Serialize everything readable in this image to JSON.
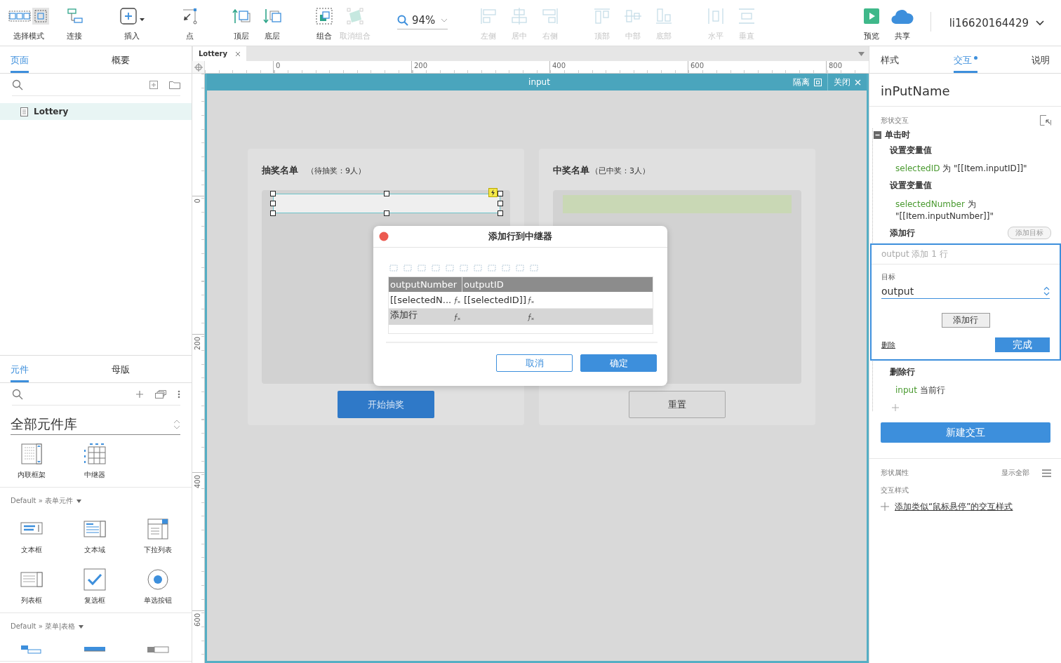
{
  "toolbar": {
    "left_groups": [
      {
        "items": [
          {
            "label": "选择模式",
            "disabled": false
          },
          {
            "label": "连接",
            "disabled": false
          }
        ]
      },
      {
        "items": [
          {
            "label": "插入",
            "disabled": false
          }
        ]
      },
      {
        "items": [
          {
            "label": "点",
            "disabled": false
          }
        ]
      },
      {
        "items": [
          {
            "label": "顶层",
            "disabled": false
          },
          {
            "label": "底层",
            "disabled": false
          }
        ]
      },
      {
        "items": [
          {
            "label": "组合",
            "disabled": false
          },
          {
            "label": "取消组合",
            "disabled": true
          }
        ]
      }
    ],
    "zoom": "94%",
    "align_groups": [
      {
        "items": [
          {
            "label": "左侧",
            "disabled": true
          },
          {
            "label": "居中",
            "disabled": true
          },
          {
            "label": "右侧",
            "disabled": true
          }
        ]
      },
      {
        "items": [
          {
            "label": "顶部",
            "disabled": true
          },
          {
            "label": "中部",
            "disabled": true
          },
          {
            "label": "底部",
            "disabled": true
          }
        ]
      },
      {
        "items": [
          {
            "label": "水平",
            "disabled": true
          },
          {
            "label": "垂直",
            "disabled": true
          }
        ]
      }
    ],
    "right_items": [
      {
        "label": "预览"
      },
      {
        "label": "共享"
      }
    ],
    "user": "li16620164429"
  },
  "left_panel": {
    "pages": {
      "tabs": [
        {
          "label": "页面",
          "selected": true
        },
        {
          "label": "概要",
          "selected": false
        }
      ],
      "items": [
        {
          "label": "Lottery",
          "selected": true
        }
      ]
    },
    "library": {
      "tabs": [
        {
          "label": "元件",
          "selected": true
        },
        {
          "label": "母版",
          "selected": false
        }
      ],
      "select": "全部元件库",
      "sections": [
        {
          "items": [
            "内联框架",
            "中继器"
          ]
        },
        {
          "title": "Default » 表单元件",
          "items": [
            "文本框",
            "文本域",
            "下拉列表",
            "列表框",
            "复选框",
            "单选按钮"
          ]
        },
        {
          "title": "Default » 菜单|表格"
        }
      ]
    }
  },
  "canvas": {
    "document_tab": "Lottery",
    "rulers": {
      "horizontal": [
        "0",
        "200",
        "400",
        "600",
        "800"
      ],
      "vertical": [
        "0",
        "200",
        "400",
        "600"
      ]
    },
    "edit_frame": {
      "title": "input",
      "buttons": [
        "隔离",
        "关闭"
      ]
    },
    "cards": [
      {
        "kind": "input-list",
        "title": "抽奖名单",
        "count": "（待抽奖：9人）",
        "button": "开始抽奖",
        "primary": true
      },
      {
        "kind": "winner-list",
        "title": "中奖名单",
        "count": "（已中奖：3人）",
        "button": "重置",
        "primary": false
      }
    ],
    "dialog": {
      "title": "添加行到中继器",
      "columns": [
        "outputNumber",
        "outputID"
      ],
      "rows": [
        {
          "kind": "data",
          "cells": [
            "[[selectedN...",
            "[[selectedID]]"
          ]
        },
        {
          "kind": "add",
          "label": "添加行"
        }
      ],
      "buttons": [
        {
          "label": "取消",
          "primary": false
        },
        {
          "label": "确定",
          "primary": true
        }
      ]
    }
  },
  "right_panel": {
    "tabs": [
      {
        "label": "样式",
        "selected": false,
        "dot": false
      },
      {
        "label": "交互",
        "selected": true,
        "dot": true
      },
      {
        "label": "说明",
        "selected": false,
        "dot": false
      }
    ],
    "element_name": "inPutName",
    "interactions": {
      "label": "形状交互",
      "events": [
        {
          "name": "单击时",
          "expanded": true,
          "actions": [
            {
              "title": "设置变量值",
              "target": "selectedID",
              "detail": "为 \"[[Item.inputID]]\""
            },
            {
              "title": "设置变量值",
              "target": "selectedNumber",
              "detail": "为\n\"[[Item.inputNumber]]\""
            },
            {
              "title": "添加行",
              "add_target": "添加目标",
              "editor": {
                "summary": "output 添加 1 行",
                "target_label": "目标",
                "target": "output",
                "add_button": "添加行",
                "delete": "删除",
                "done": "完成"
              }
            },
            {
              "title": "删除行",
              "target": "input",
              "detail": "当前行"
            }
          ]
        }
      ]
    },
    "new_interaction": "新建交互",
    "properties": {
      "label": "形状属性",
      "show_all": "显示全部",
      "style_label": "交互样式",
      "add_style": "添加类似“鼠标悬停”的交互样式"
    }
  }
}
